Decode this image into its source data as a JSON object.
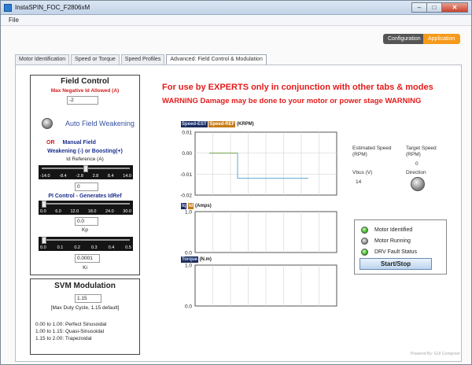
{
  "window": {
    "title": "InstaSPIN_FOC_F2806xM",
    "minimize": "–",
    "maximize": "□",
    "close": "✕"
  },
  "menu": {
    "file": "File"
  },
  "mode": {
    "configuration": "Configuration",
    "application": "Application",
    "active": "Application"
  },
  "tabs": [
    {
      "label": "Motor Identification",
      "active": false
    },
    {
      "label": "Speed or Torque",
      "active": false
    },
    {
      "label": "Speed Profiles",
      "active": false
    },
    {
      "label": "Advanced: Field Control & Modulation",
      "active": true
    }
  ],
  "field_control": {
    "title": "Field Control",
    "max_neg_id_label": "Max Negative Id Allowed (A)",
    "max_neg_id_value": "-2",
    "auto_field_weakening": "Auto Field Weakening",
    "or": "OR",
    "manual_field": "Manual Field",
    "weakening_line": "Weakening (-) or Boosting(+)",
    "id_reference_label": "Id Reference (A)",
    "id_slider": {
      "ticks": [
        "-14.0",
        "-8.4",
        "-2.8",
        "2.8",
        "8.4",
        "14.0"
      ],
      "value": 0,
      "min": -14,
      "max": 14
    },
    "id_value": "0",
    "pi_title": "PI Control - Generates IdRef",
    "kp_slider": {
      "ticks": [
        "0.0",
        "6.0",
        "12.0",
        "18.0",
        "24.0",
        "30.0"
      ],
      "value": 0,
      "min": 0,
      "max": 30
    },
    "kp_value": "0.0",
    "kp_label": "Kp",
    "ki_slider": {
      "ticks": [
        "0.0",
        "0.1",
        "0.2",
        "0.3",
        "0.4",
        "0.5"
      ],
      "value": 0.0001,
      "min": 0,
      "max": 0.5
    },
    "ki_value": "0.0001",
    "ki_label": "Ki"
  },
  "svm": {
    "title": "SVM Modulation",
    "value": "1.15",
    "description": "[Max Duty Cycle, 1.15 default]",
    "modes": [
      "0.00 to 1.00: Perfect Sinusoidal",
      "1.00 to 1.15: Quasi-Sinusoidal",
      "1.15 to 2.00: Trapezoidal"
    ]
  },
  "warnings": {
    "line1": "For use by EXPERTS only in conjunction with other tabs & modes",
    "line2": "WARNING Damage may be done to your motor or power stage WARNING"
  },
  "chart_data": [
    {
      "type": "line",
      "legend": [
        "Speed-EST",
        "Speed-REF"
      ],
      "unit": "(KRPM)",
      "yticks": [
        "0.01",
        "0.00",
        "-0.01",
        "-0.02"
      ],
      "ylim": [
        -0.02,
        0.01
      ],
      "x": [
        0,
        1,
        2,
        3,
        4,
        5,
        6,
        7,
        8,
        9,
        10
      ],
      "series": [
        {
          "name": "Speed-EST",
          "color": "#5fa8d8",
          "values": [
            null,
            0.0,
            0.0,
            -0.012,
            -0.012,
            -0.012,
            -0.012,
            -0.012,
            -0.012,
            null,
            null
          ]
        },
        {
          "name": "Speed-REF",
          "color": "#8aaa4a",
          "values": [
            null,
            0.0,
            0.0,
            0.0,
            null,
            null,
            null,
            null,
            null,
            null,
            null
          ]
        }
      ]
    },
    {
      "type": "line",
      "legend": [
        "Iq",
        "Id"
      ],
      "unit": "(Amps)",
      "yticks": [
        "1.0",
        "0.0"
      ],
      "ylim": [
        0,
        1
      ],
      "series": []
    },
    {
      "type": "line",
      "legend": [
        "Torque"
      ],
      "unit": "(N.m)",
      "yticks": [
        "1.0",
        "0.0"
      ],
      "ylim": [
        0,
        1
      ],
      "series": []
    }
  ],
  "right_panel": {
    "estimated_speed_label": "Estimated Speed",
    "estimated_speed_unit": "(RPM)",
    "target_speed_label": "Target Speed",
    "target_speed_unit": "(RPM)",
    "target_speed_value": "0",
    "vbus_label": "Vbus (V)",
    "vbus_value": "14",
    "direction_label": "Direction"
  },
  "status": {
    "motor_identified": "Motor Identified",
    "motor_running": "Motor Running",
    "drv_fault": "DRV Fault Status",
    "start_stop": "Start/Stop",
    "colors": {
      "identified": "#3fbb25",
      "running": "#8e8e8e",
      "fault": "#3fbb25"
    }
  },
  "footer": "Powered By: GUI Composer"
}
